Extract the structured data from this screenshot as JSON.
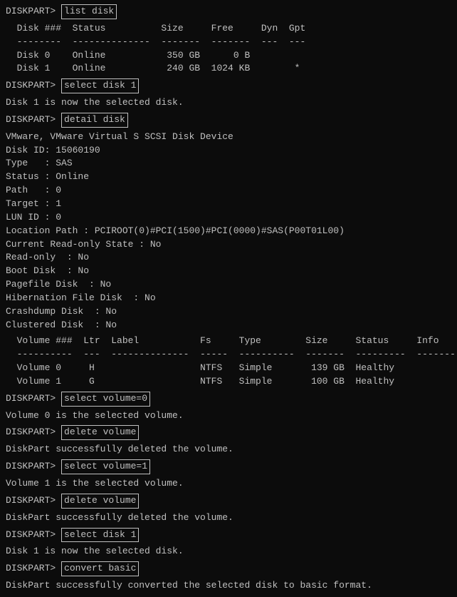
{
  "terminal": {
    "lines": [
      {
        "type": "prompt",
        "prompt": "DISKPART> ",
        "command": "list disk"
      },
      {
        "type": "blank"
      },
      {
        "type": "text",
        "content": "  Disk ###  Status          Size     Free     Dyn  Gpt"
      },
      {
        "type": "text",
        "content": "  --------  --------------  -------  -------  ---  ---"
      },
      {
        "type": "text",
        "content": "  Disk 0    Online           350 GB      0 B"
      },
      {
        "type": "text",
        "content": "  Disk 1    Online           240 GB  1024 KB        *"
      },
      {
        "type": "blank"
      },
      {
        "type": "prompt",
        "prompt": "DISKPART> ",
        "command": "select disk 1"
      },
      {
        "type": "blank"
      },
      {
        "type": "text",
        "content": "Disk 1 is now the selected disk."
      },
      {
        "type": "blank"
      },
      {
        "type": "prompt",
        "prompt": "DISKPART> ",
        "command": "detail disk"
      },
      {
        "type": "blank"
      },
      {
        "type": "text",
        "content": "VMware, VMware Virtual S SCSI Disk Device"
      },
      {
        "type": "text",
        "content": "Disk ID: 15060190"
      },
      {
        "type": "text",
        "content": "Type   : SAS"
      },
      {
        "type": "text",
        "content": "Status : Online"
      },
      {
        "type": "text",
        "content": "Path   : 0"
      },
      {
        "type": "text",
        "content": "Target : 1"
      },
      {
        "type": "text",
        "content": "LUN ID : 0"
      },
      {
        "type": "text",
        "content": "Location Path : PCIROOT(0)#PCI(1500)#PCI(0000)#SAS(P00T01L00)"
      },
      {
        "type": "text",
        "content": "Current Read-only State : No"
      },
      {
        "type": "text",
        "content": "Read-only  : No"
      },
      {
        "type": "text",
        "content": "Boot Disk  : No"
      },
      {
        "type": "text",
        "content": "Pagefile Disk  : No"
      },
      {
        "type": "text",
        "content": "Hibernation File Disk  : No"
      },
      {
        "type": "text",
        "content": "Crashdump Disk  : No"
      },
      {
        "type": "text",
        "content": "Clustered Disk  : No"
      },
      {
        "type": "blank"
      },
      {
        "type": "text",
        "content": "  Volume ###  Ltr  Label           Fs     Type        Size     Status     Info"
      },
      {
        "type": "text",
        "content": "  ----------  ---  --------------  -----  ----------  -------  ---------  ----------"
      },
      {
        "type": "text",
        "content": "  Volume 0     H                   NTFS   Simple       139 GB  Healthy"
      },
      {
        "type": "text",
        "content": "  Volume 1     G                   NTFS   Simple       100 GB  Healthy"
      },
      {
        "type": "blank"
      },
      {
        "type": "prompt",
        "prompt": "DISKPART> ",
        "command": "select volume=0"
      },
      {
        "type": "blank"
      },
      {
        "type": "text",
        "content": "Volume 0 is the selected volume."
      },
      {
        "type": "blank"
      },
      {
        "type": "prompt",
        "prompt": "DISKPART> ",
        "command": "delete volume"
      },
      {
        "type": "blank"
      },
      {
        "type": "text",
        "content": "DiskPart successfully deleted the volume."
      },
      {
        "type": "blank"
      },
      {
        "type": "prompt",
        "prompt": "DISKPART> ",
        "command": "select volume=1"
      },
      {
        "type": "blank"
      },
      {
        "type": "text",
        "content": "Volume 1 is the selected volume."
      },
      {
        "type": "blank"
      },
      {
        "type": "prompt",
        "prompt": "DISKPART> ",
        "command": "delete volume"
      },
      {
        "type": "blank"
      },
      {
        "type": "text",
        "content": "DiskPart successfully deleted the volume."
      },
      {
        "type": "blank"
      },
      {
        "type": "prompt",
        "prompt": "DISKPART> ",
        "command": "select disk 1"
      },
      {
        "type": "blank"
      },
      {
        "type": "text",
        "content": "Disk 1 is now the selected disk."
      },
      {
        "type": "blank"
      },
      {
        "type": "prompt",
        "prompt": "DISKPART> ",
        "command": "convert basic"
      },
      {
        "type": "blank"
      },
      {
        "type": "text",
        "content": "DiskPart successfully converted the selected disk to basic format."
      }
    ]
  }
}
